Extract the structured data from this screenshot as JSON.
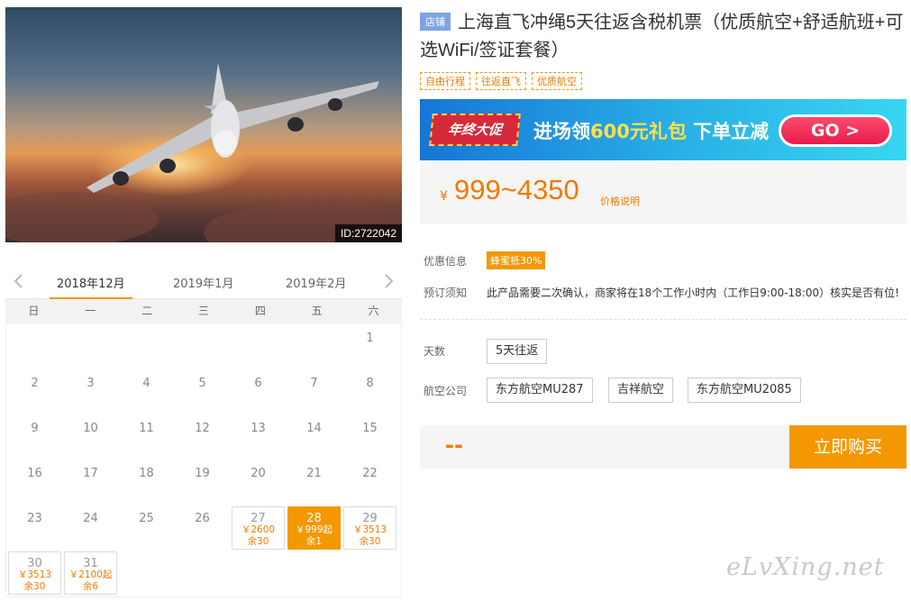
{
  "hero": {
    "id_label": "ID:2722042"
  },
  "calendar": {
    "prev_label": "<",
    "next_label": ">",
    "months": [
      "2018年12月",
      "2019年1月",
      "2019年2月"
    ],
    "active_month_index": 0,
    "weekdays": [
      "日",
      "一",
      "二",
      "三",
      "四",
      "五",
      "六"
    ],
    "plain_days": [
      "1",
      "2",
      "3",
      "4",
      "5",
      "6",
      "7",
      "8",
      "9",
      "10",
      "11",
      "12",
      "13",
      "14",
      "15",
      "16",
      "17",
      "18",
      "19",
      "20",
      "21",
      "22",
      "23",
      "24",
      "25",
      "26"
    ],
    "available_days": [
      {
        "day": "27",
        "price": "￥2600",
        "left": "余30",
        "selected": false
      },
      {
        "day": "28",
        "price": "￥999起",
        "left": "余1",
        "selected": true
      },
      {
        "day": "29",
        "price": "￥3513",
        "left": "余30",
        "selected": false
      },
      {
        "day": "30",
        "price": "￥3513",
        "left": "余30",
        "selected": false
      },
      {
        "day": "31",
        "price": "￥2100起",
        "left": "余6",
        "selected": false
      }
    ]
  },
  "product": {
    "badge": "店铺",
    "title": "上海直飞冲绳5天往返含税机票（优质航空+舒适航班+可选WiFi/签证套餐）",
    "tags": [
      "自由行程",
      "往返直飞",
      "优质航空"
    ]
  },
  "banner": {
    "badge": "年终大促",
    "text_prefix": "进场领",
    "text_highlight": "600元礼包",
    "text_suffix": " 下单立减",
    "go": "GO >"
  },
  "price": {
    "currency": "¥",
    "range": "999~4350",
    "note": "价格说明"
  },
  "info": {
    "promo_label": "优惠信息",
    "promo_tag": "蜂蜜抵30%",
    "notice_label": "预订须知",
    "notice_text": "此产品需要二次确认，商家将在18个工作小时内（工作日9:00-18:00）核实是否有位!"
  },
  "options": {
    "days_label": "天数",
    "days": [
      "5天往返"
    ],
    "airline_label": "航空公司",
    "airlines": [
      "东方航空MU287",
      "吉祥航空",
      "东方航空MU2085"
    ]
  },
  "purchase": {
    "total": "--",
    "buy_label": "立即购买"
  },
  "watermark": "eLvXing.net",
  "colors": {
    "accent": "#f39800",
    "price": "#ef7a00",
    "badge": "#7ea4e2"
  }
}
